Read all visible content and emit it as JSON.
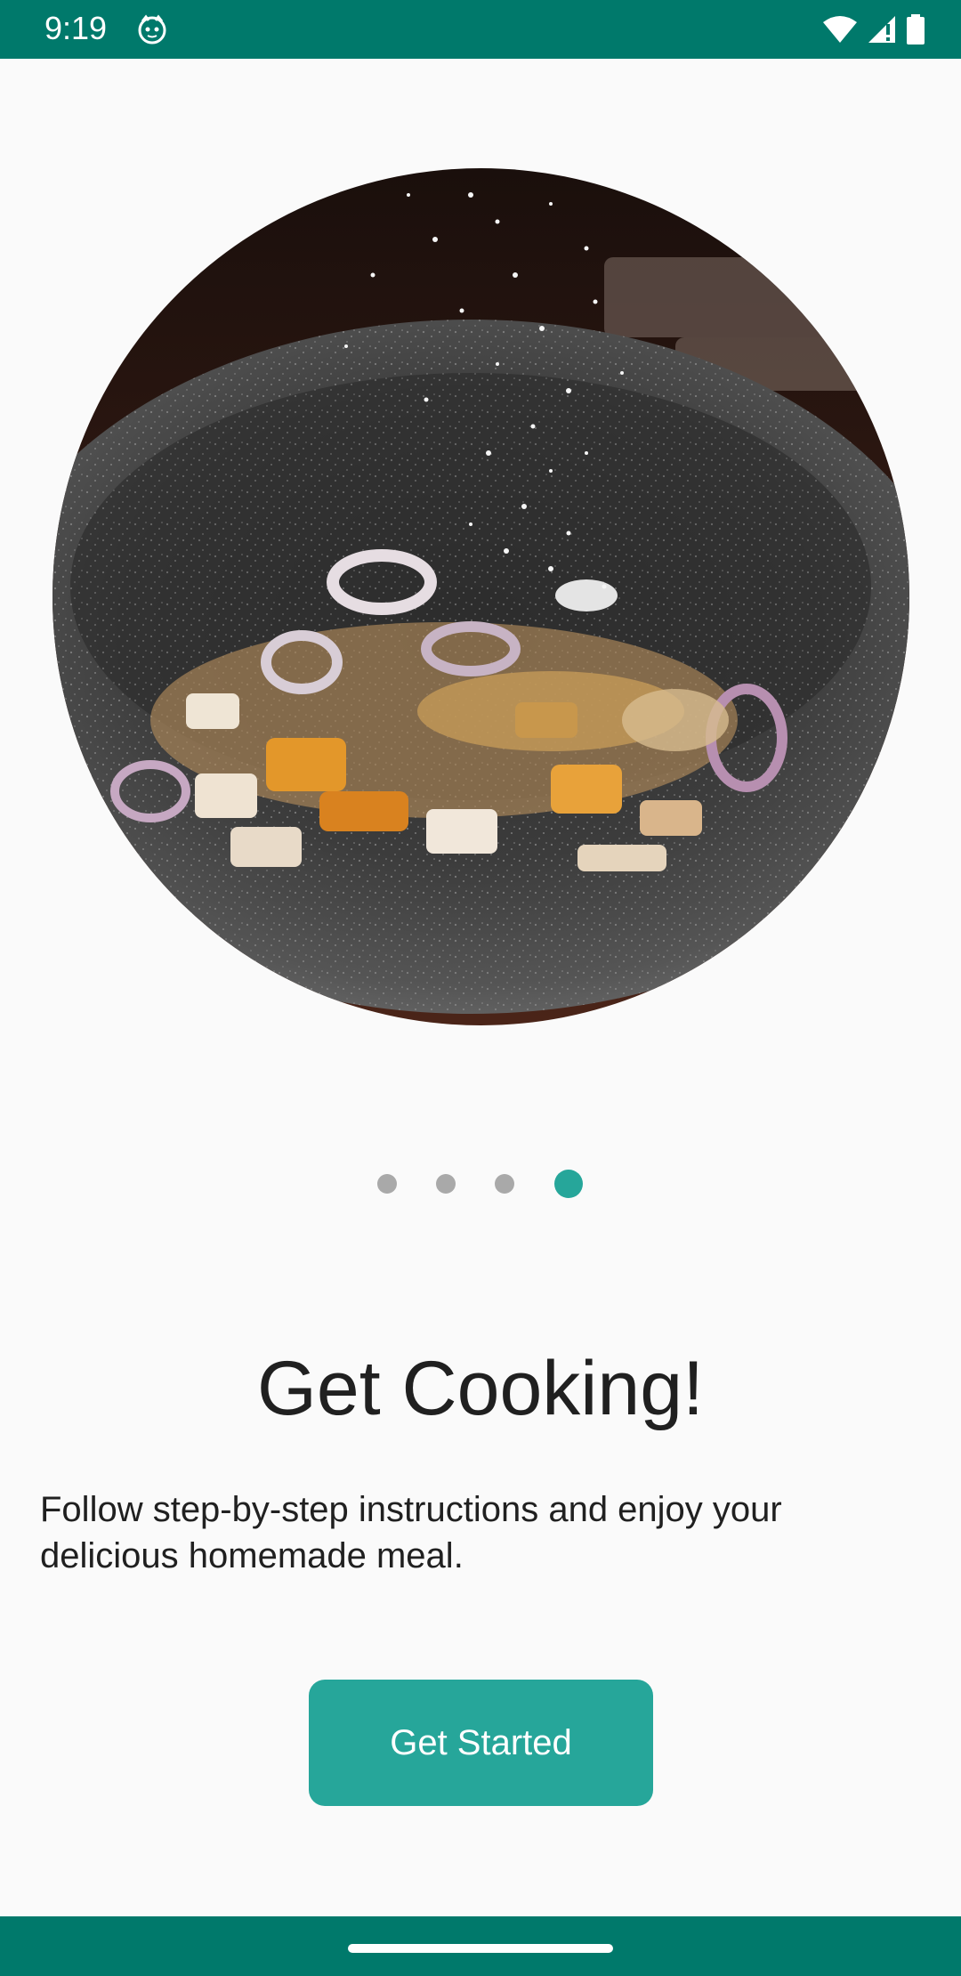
{
  "status_bar": {
    "time": "9:19",
    "icons": [
      "app-notification-icon",
      "wifi-icon",
      "signal-icon",
      "battery-icon"
    ],
    "background": "#00796b"
  },
  "hero": {
    "image": "wok-with-vegetables-and-spices-photo"
  },
  "pager": {
    "count": 4,
    "active_index": 3,
    "active_color": "#26a69a",
    "inactive_color": "#a9a9a9"
  },
  "onboarding": {
    "title": "Get Cooking!",
    "description": "Follow step-by-step instructions and enjoy your delicious homemade meal.",
    "button_label": "Get Started"
  },
  "colors": {
    "accent": "#26a69a",
    "primary_dark": "#00796b",
    "background": "#fafafa",
    "text": "#202020"
  }
}
